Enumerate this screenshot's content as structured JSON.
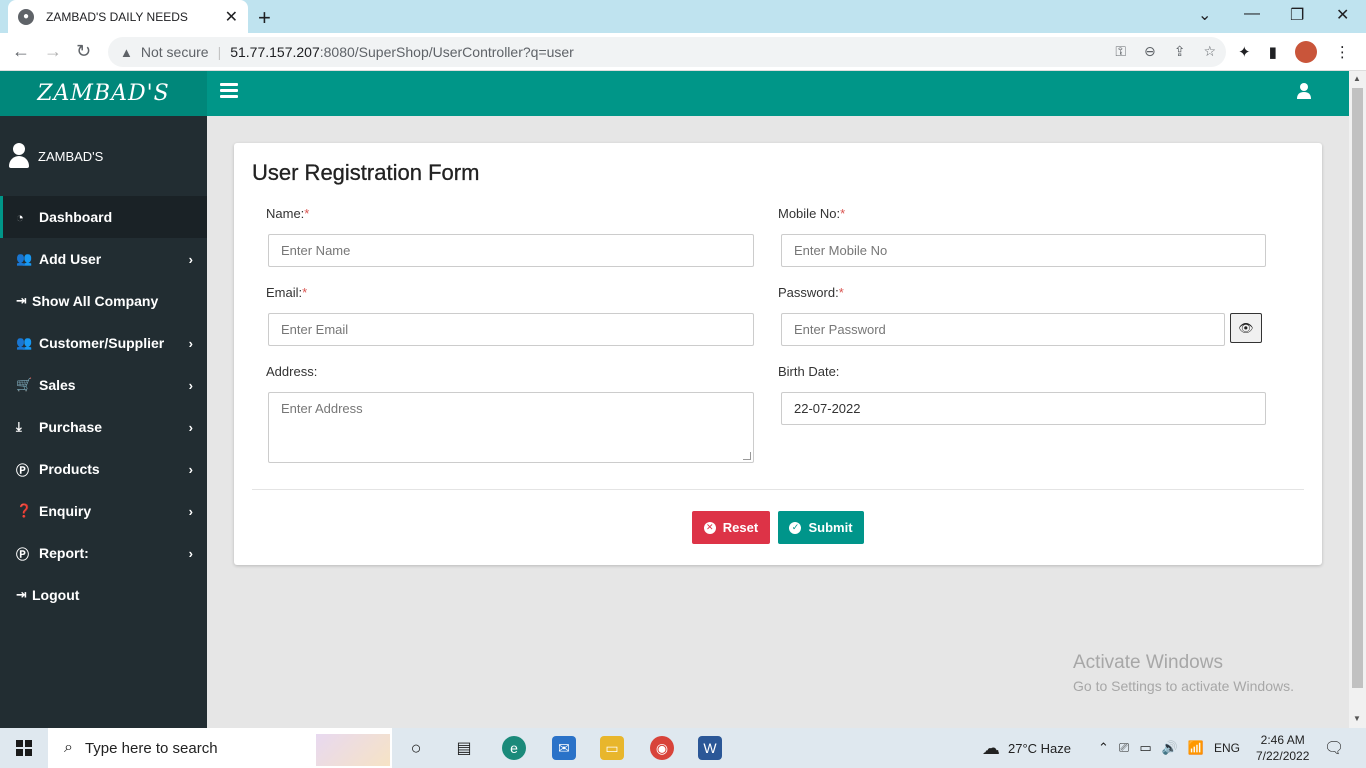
{
  "browser": {
    "tab_title": "ZAMBAD'S DAILY NEEDS",
    "security_label": "Not secure",
    "url_host": "51.77.157.207",
    "url_rest": ":8080/SuperShop/UserController?q=user"
  },
  "app": {
    "brand": "ZAMBAD'S",
    "accent": "#009688"
  },
  "sidebar": {
    "user_name": "ZAMBAD'S",
    "items": [
      {
        "label": "Dashboard",
        "icon": "dashboard-icon",
        "chevron": false
      },
      {
        "label": "Add User",
        "icon": "users-icon",
        "chevron": true
      },
      {
        "label": "Show All Company",
        "icon": "signin-icon",
        "chevron": false
      },
      {
        "label": "Customer/Supplier",
        "icon": "users-icon",
        "chevron": true
      },
      {
        "label": "Sales",
        "icon": "cart-icon",
        "chevron": true
      },
      {
        "label": "Purchase",
        "icon": "download-icon",
        "chevron": true
      },
      {
        "label": "Products",
        "icon": "product-icon",
        "chevron": true
      },
      {
        "label": "Enquiry",
        "icon": "question-icon",
        "chevron": true
      },
      {
        "label": "Report:",
        "icon": "report-icon",
        "chevron": true
      },
      {
        "label": "Logout",
        "icon": "signout-icon",
        "chevron": false
      }
    ]
  },
  "form": {
    "title": "User Registration Form",
    "name_label": "Name:",
    "name_placeholder": "Enter Name",
    "mobile_label": "Mobile No:",
    "mobile_placeholder": "Enter Mobile No",
    "email_label": "Email:",
    "email_placeholder": "Enter Email",
    "password_label": "Password:",
    "password_placeholder": "Enter Password",
    "address_label": "Address:",
    "address_placeholder": "Enter Address",
    "birth_label": "Birth Date:",
    "birth_value": "22-07-2022",
    "required_mark": "*",
    "reset_label": "Reset",
    "submit_label": "Submit"
  },
  "watermark": {
    "line1": "Activate Windows",
    "line2": "Go to Settings to activate Windows."
  },
  "taskbar": {
    "search_placeholder": "Type here to search",
    "weather": "27°C  Haze",
    "lang": "ENG",
    "time": "2:46 AM",
    "date": "7/22/2022"
  }
}
